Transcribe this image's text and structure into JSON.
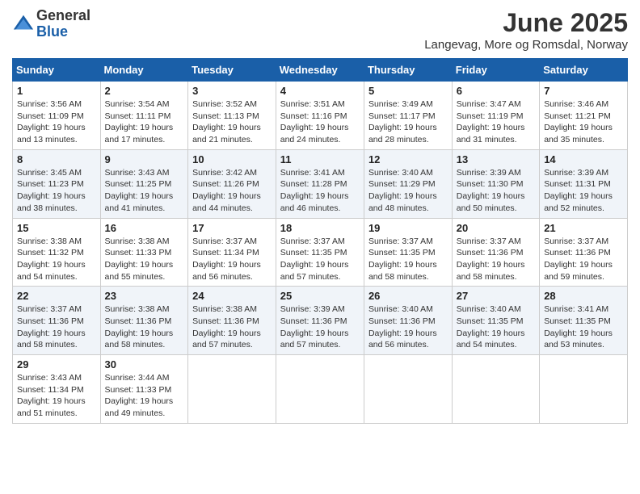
{
  "header": {
    "logo_general": "General",
    "logo_blue": "Blue",
    "month_title": "June 2025",
    "location": "Langevag, More og Romsdal, Norway"
  },
  "weekdays": [
    "Sunday",
    "Monday",
    "Tuesday",
    "Wednesday",
    "Thursday",
    "Friday",
    "Saturday"
  ],
  "weeks": [
    [
      {
        "day": "1",
        "sunrise": "3:56 AM",
        "sunset": "11:09 PM",
        "daylight": "19 hours and 13 minutes."
      },
      {
        "day": "2",
        "sunrise": "3:54 AM",
        "sunset": "11:11 PM",
        "daylight": "19 hours and 17 minutes."
      },
      {
        "day": "3",
        "sunrise": "3:52 AM",
        "sunset": "11:13 PM",
        "daylight": "19 hours and 21 minutes."
      },
      {
        "day": "4",
        "sunrise": "3:51 AM",
        "sunset": "11:16 PM",
        "daylight": "19 hours and 24 minutes."
      },
      {
        "day": "5",
        "sunrise": "3:49 AM",
        "sunset": "11:17 PM",
        "daylight": "19 hours and 28 minutes."
      },
      {
        "day": "6",
        "sunrise": "3:47 AM",
        "sunset": "11:19 PM",
        "daylight": "19 hours and 31 minutes."
      },
      {
        "day": "7",
        "sunrise": "3:46 AM",
        "sunset": "11:21 PM",
        "daylight": "19 hours and 35 minutes."
      }
    ],
    [
      {
        "day": "8",
        "sunrise": "3:45 AM",
        "sunset": "11:23 PM",
        "daylight": "19 hours and 38 minutes."
      },
      {
        "day": "9",
        "sunrise": "3:43 AM",
        "sunset": "11:25 PM",
        "daylight": "19 hours and 41 minutes."
      },
      {
        "day": "10",
        "sunrise": "3:42 AM",
        "sunset": "11:26 PM",
        "daylight": "19 hours and 44 minutes."
      },
      {
        "day": "11",
        "sunrise": "3:41 AM",
        "sunset": "11:28 PM",
        "daylight": "19 hours and 46 minutes."
      },
      {
        "day": "12",
        "sunrise": "3:40 AM",
        "sunset": "11:29 PM",
        "daylight": "19 hours and 48 minutes."
      },
      {
        "day": "13",
        "sunrise": "3:39 AM",
        "sunset": "11:30 PM",
        "daylight": "19 hours and 50 minutes."
      },
      {
        "day": "14",
        "sunrise": "3:39 AM",
        "sunset": "11:31 PM",
        "daylight": "19 hours and 52 minutes."
      }
    ],
    [
      {
        "day": "15",
        "sunrise": "3:38 AM",
        "sunset": "11:32 PM",
        "daylight": "19 hours and 54 minutes."
      },
      {
        "day": "16",
        "sunrise": "3:38 AM",
        "sunset": "11:33 PM",
        "daylight": "19 hours and 55 minutes."
      },
      {
        "day": "17",
        "sunrise": "3:37 AM",
        "sunset": "11:34 PM",
        "daylight": "19 hours and 56 minutes."
      },
      {
        "day": "18",
        "sunrise": "3:37 AM",
        "sunset": "11:35 PM",
        "daylight": "19 hours and 57 minutes."
      },
      {
        "day": "19",
        "sunrise": "3:37 AM",
        "sunset": "11:35 PM",
        "daylight": "19 hours and 58 minutes."
      },
      {
        "day": "20",
        "sunrise": "3:37 AM",
        "sunset": "11:36 PM",
        "daylight": "19 hours and 58 minutes."
      },
      {
        "day": "21",
        "sunrise": "3:37 AM",
        "sunset": "11:36 PM",
        "daylight": "19 hours and 59 minutes."
      }
    ],
    [
      {
        "day": "22",
        "sunrise": "3:37 AM",
        "sunset": "11:36 PM",
        "daylight": "19 hours and 58 minutes."
      },
      {
        "day": "23",
        "sunrise": "3:38 AM",
        "sunset": "11:36 PM",
        "daylight": "19 hours and 58 minutes."
      },
      {
        "day": "24",
        "sunrise": "3:38 AM",
        "sunset": "11:36 PM",
        "daylight": "19 hours and 57 minutes."
      },
      {
        "day": "25",
        "sunrise": "3:39 AM",
        "sunset": "11:36 PM",
        "daylight": "19 hours and 57 minutes."
      },
      {
        "day": "26",
        "sunrise": "3:40 AM",
        "sunset": "11:36 PM",
        "daylight": "19 hours and 56 minutes."
      },
      {
        "day": "27",
        "sunrise": "3:40 AM",
        "sunset": "11:35 PM",
        "daylight": "19 hours and 54 minutes."
      },
      {
        "day": "28",
        "sunrise": "3:41 AM",
        "sunset": "11:35 PM",
        "daylight": "19 hours and 53 minutes."
      }
    ],
    [
      {
        "day": "29",
        "sunrise": "3:43 AM",
        "sunset": "11:34 PM",
        "daylight": "19 hours and 51 minutes."
      },
      {
        "day": "30",
        "sunrise": "3:44 AM",
        "sunset": "11:33 PM",
        "daylight": "19 hours and 49 minutes."
      },
      null,
      null,
      null,
      null,
      null
    ]
  ],
  "labels": {
    "sunrise_prefix": "Sunrise: ",
    "sunset_prefix": "Sunset: ",
    "daylight_prefix": "Daylight: "
  }
}
